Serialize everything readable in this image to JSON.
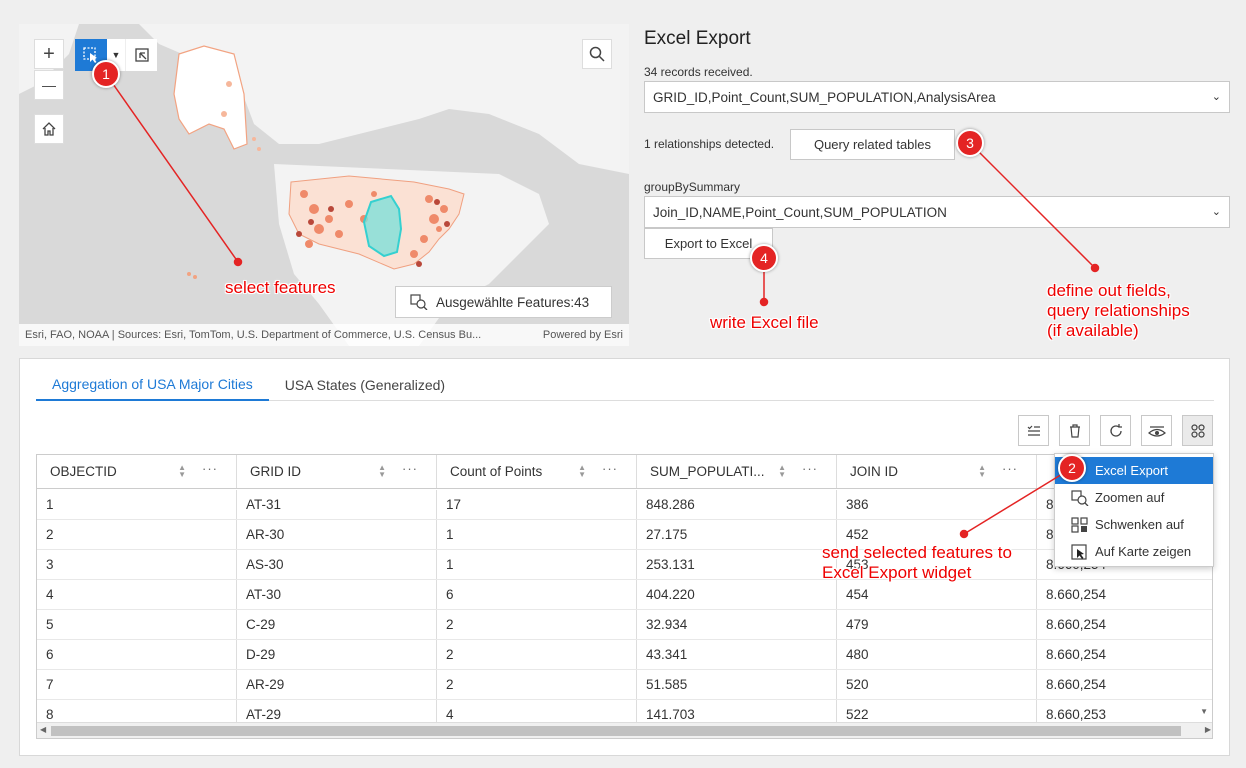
{
  "map": {
    "selection_count_label": "Ausgewählte Features:43",
    "attribution": "Esri, FAO, NOAA | Sources: Esri, TomTom, U.S. Department of Commerce, U.S. Census Bu...",
    "powered_by": "Powered by Esri",
    "zoom_in": "+",
    "zoom_out": "—"
  },
  "export": {
    "title": "Excel Export",
    "records_label": "34 records received.",
    "fields_value": "GRID_ID,Point_Count,SUM_POPULATION,AnalysisArea",
    "relationships_label": "1 relationships detected.",
    "query_button": "Query related tables",
    "group_label": "groupBySummary",
    "group_value": "Join_ID,NAME,Point_Count,SUM_POPULATION",
    "export_button": "Export to Excel"
  },
  "table": {
    "tabs": [
      {
        "label": "Aggregation of USA Major Cities",
        "active": true
      },
      {
        "label": "USA States (Generalized)",
        "active": false
      }
    ],
    "columns": [
      "OBJECTID",
      "GRID ID",
      "Count of Points",
      "SUM_POPULATI...",
      "JOIN ID",
      ""
    ],
    "rows": [
      [
        "1",
        "AT-31",
        "17",
        "848.286",
        "386",
        "8"
      ],
      [
        "2",
        "AR-30",
        "1",
        "27.175",
        "452",
        "8"
      ],
      [
        "3",
        "AS-30",
        "1",
        "253.131",
        "453",
        "8.660,254"
      ],
      [
        "4",
        "AT-30",
        "6",
        "404.220",
        "454",
        "8.660,254"
      ],
      [
        "5",
        "C-29",
        "2",
        "32.934",
        "479",
        "8.660,254"
      ],
      [
        "6",
        "D-29",
        "2",
        "43.341",
        "480",
        "8.660,254"
      ],
      [
        "7",
        "AR-29",
        "2",
        "51.585",
        "520",
        "8.660,254"
      ],
      [
        "8",
        "AT-29",
        "4",
        "141.703",
        "522",
        "8.660,253"
      ]
    ]
  },
  "menu": {
    "items": [
      "Excel Export",
      "Zoomen auf",
      "Schwenken auf",
      "Auf Karte zeigen"
    ]
  },
  "annotations": {
    "a1": {
      "number": "1",
      "text": "select features"
    },
    "a2": {
      "number": "2",
      "line1": "send selected features to",
      "line2": "Excel Export widget"
    },
    "a3": {
      "number": "3",
      "line1": "define out fields,",
      "line2": "query relationships",
      "line3": "(if available)"
    },
    "a4": {
      "number": "4",
      "text": "write Excel file"
    }
  },
  "colors": {
    "accent": "#1e7ad6",
    "annotation": "#ee0000"
  }
}
